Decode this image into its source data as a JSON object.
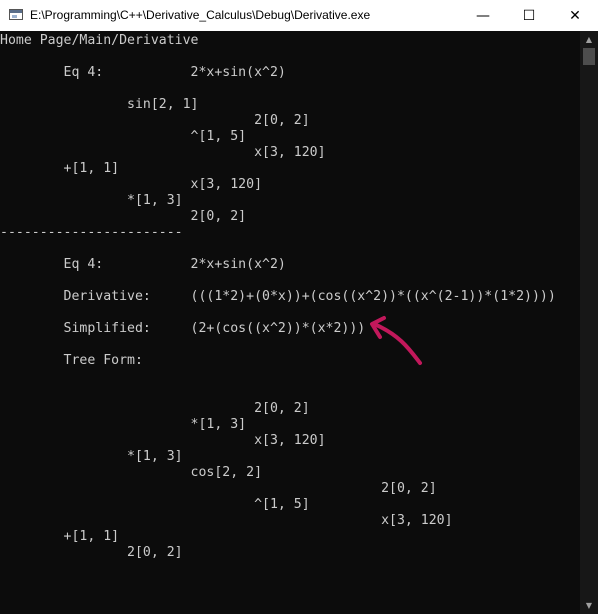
{
  "window": {
    "title": "E:\\Programming\\C++\\Derivative_Calculus\\Debug\\Derivative.exe",
    "minimize_glyph": "—",
    "maximize_glyph": "☐",
    "close_glyph": "✕"
  },
  "console": {
    "lines": [
      "Home Page/Main/Derivative",
      "",
      "        Eq 4:           2*x+sin(x^2)",
      "",
      "                sin[2, 1]",
      "                                2[0, 2]",
      "                        ^[1, 5]",
      "                                x[3, 120]",
      "        +[1, 1]",
      "                        x[3, 120]",
      "                *[1, 3]",
      "                        2[0, 2]",
      "-----------------------",
      "",
      "        Eq 4:           2*x+sin(x^2)",
      "",
      "        Derivative:     (((1*2)+(0*x))+(cos((x^2))*((x^(2-1))*(1*2))))",
      "",
      "        Simplified:     (2+(cos((x^2))*(x*2)))",
      "",
      "        Tree Form:",
      "",
      "",
      "                                2[0, 2]",
      "                        *[1, 3]",
      "                                x[3, 120]",
      "                *[1, 3]",
      "                        cos[2, 2]",
      "                                                2[0, 2]",
      "                                ^[1, 5]",
      "                                                x[3, 120]",
      "        +[1, 1]",
      "                2[0, 2]"
    ]
  },
  "scrollbar": {
    "up_glyph": "▲",
    "down_glyph": "▼"
  },
  "colors": {
    "console_bg": "#0c0c0c",
    "console_text": "#cccccc",
    "annotation_arrow": "#c2185b"
  }
}
